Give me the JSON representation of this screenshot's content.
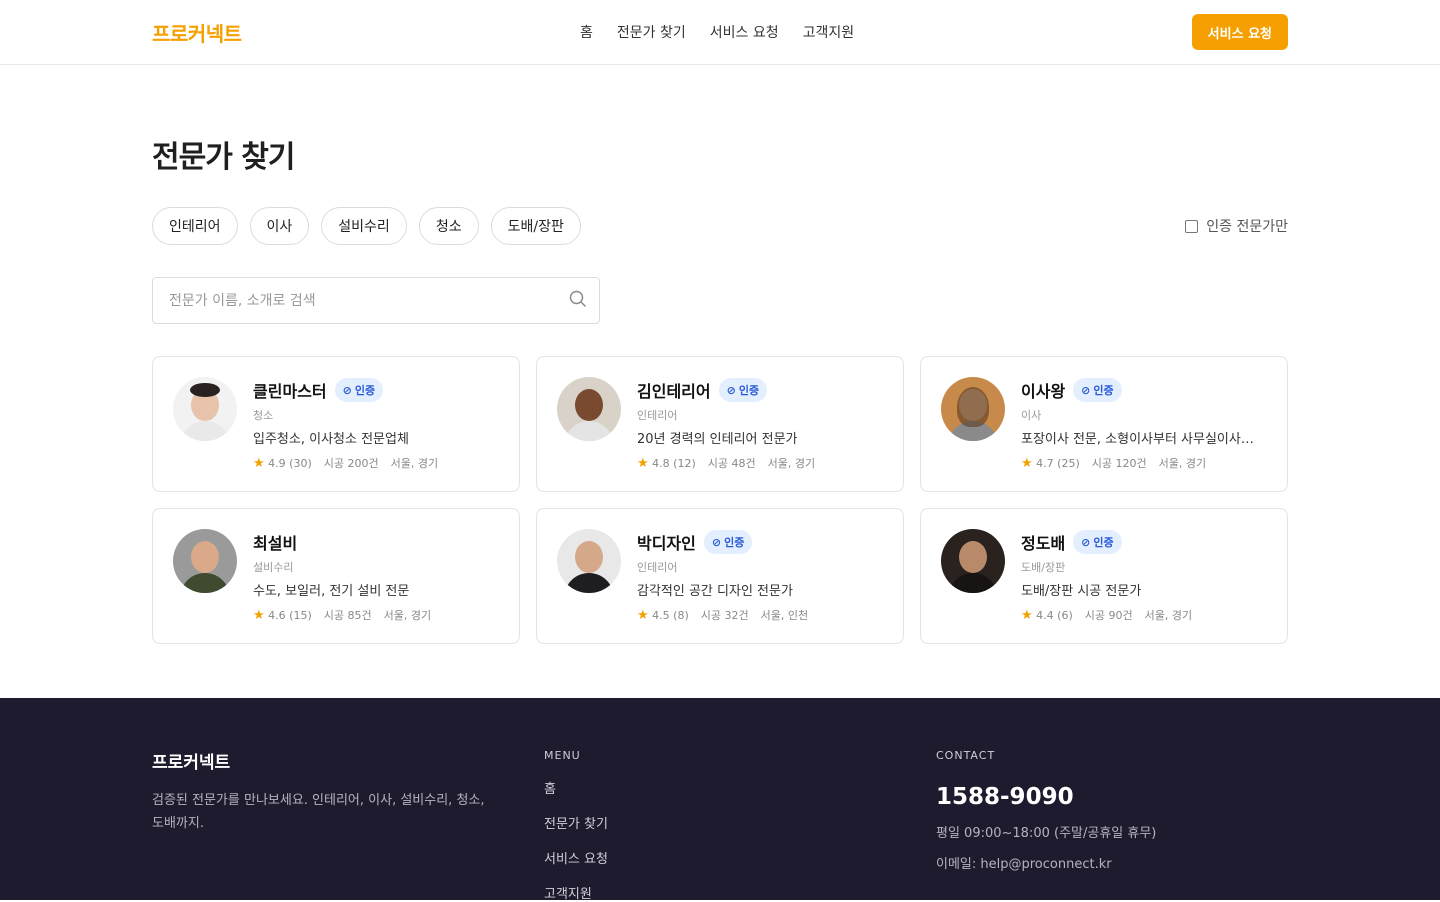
{
  "header": {
    "logo": "프로커넥트",
    "nav": [
      "홈",
      "전문가 찾기",
      "서비스 요청",
      "고객지원"
    ],
    "cta_label": "서비스 요청"
  },
  "main": {
    "title": "전문가 찾기",
    "filters": [
      "인테리어",
      "이사",
      "설비수리",
      "청소",
      "도배/장판"
    ],
    "verified_only_label": "인증 전문가만",
    "search_placeholder": "전문가 이름, 소개로 검색"
  },
  "experts": [
    {
      "name": "클린마스터",
      "verified": true,
      "badge": "인증",
      "category": "청소",
      "desc": "입주청소, 이사청소 전문업체",
      "rating": "4.9",
      "reviews": "(30)",
      "jobs": "시공 200건",
      "area": "서울, 경기"
    },
    {
      "name": "김인테리어",
      "verified": true,
      "badge": "인증",
      "category": "인테리어",
      "desc": "20년 경력의 인테리어 전문가",
      "rating": "4.8",
      "reviews": "(12)",
      "jobs": "시공 48건",
      "area": "서울, 경기"
    },
    {
      "name": "이사왕",
      "verified": true,
      "badge": "인증",
      "category": "이사",
      "desc": "포장이사 전문, 소형이사부터 사무실이사까지",
      "rating": "4.7",
      "reviews": "(25)",
      "jobs": "시공 120건",
      "area": "서울, 경기"
    },
    {
      "name": "최설비",
      "verified": false,
      "badge": "",
      "category": "설비수리",
      "desc": "수도, 보일러, 전기 설비 전문",
      "rating": "4.6",
      "reviews": "(15)",
      "jobs": "시공 85건",
      "area": "서울, 경기"
    },
    {
      "name": "박디자인",
      "verified": true,
      "badge": "인증",
      "category": "인테리어",
      "desc": "감각적인 공간 디자인 전문가",
      "rating": "4.5",
      "reviews": "(8)",
      "jobs": "시공 32건",
      "area": "서울, 인천"
    },
    {
      "name": "정도배",
      "verified": true,
      "badge": "인증",
      "category": "도배/장판",
      "desc": "도배/장판 시공 전문가",
      "rating": "4.4",
      "reviews": "(6)",
      "jobs": "시공 90건",
      "area": "서울, 경기"
    }
  ],
  "footer": {
    "brand": "프로커넥트",
    "desc": "검증된 전문가를 만나보세요. 인테리어, 이사, 설비수리, 청소, 도배까지.",
    "menu_heading": "MENU",
    "menu": [
      "홈",
      "전문가 찾기",
      "서비스 요청",
      "고객지원"
    ],
    "contact_heading": "CONTACT",
    "phone": "1588-9090",
    "hours": "평일 09:00~18:00 (주말/공휴일 휴무)",
    "email": "이메일: help@proconnect.kr"
  },
  "colors": {
    "accent": "#f5a000",
    "badge_bg": "#e3eeff",
    "badge_text": "#2a5bd7",
    "footer_bg": "#1e1b2e"
  }
}
